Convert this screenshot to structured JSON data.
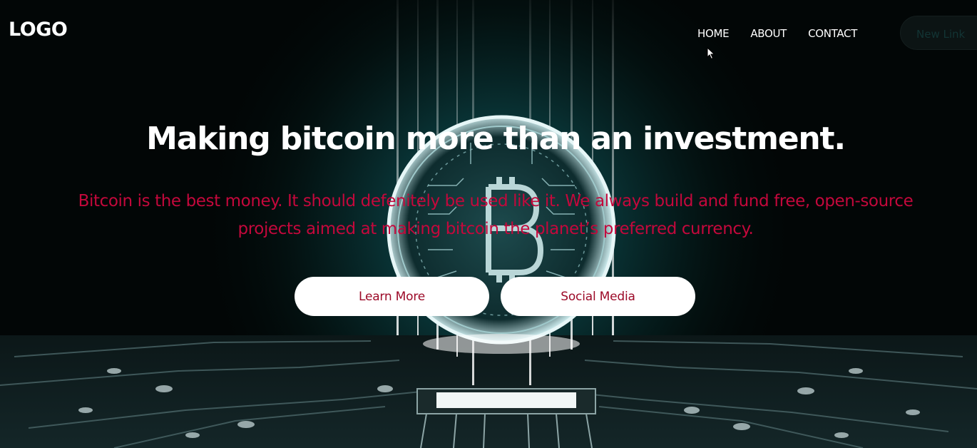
{
  "header": {
    "logo": "LOGO",
    "nav": [
      "HOME",
      "ABOUT",
      "CONTACT"
    ],
    "cta": "New Link"
  },
  "hero": {
    "headline": "Making bitcoin more than an investment.",
    "subtext_line1": "Bitcoin is the best money. It should defenitely be used like it. We always build and fund free, open-source",
    "subtext_line2": "projects aimed at making bitcoin the planet’s preferred currency.",
    "buttons": [
      "Learn More",
      "Social Media"
    ],
    "background_icon": "bitcoin-circuit-coin",
    "colors": {
      "subtext": "#c4083c",
      "button_text": "#9c0a28",
      "glow": "#2fb0b4"
    }
  }
}
